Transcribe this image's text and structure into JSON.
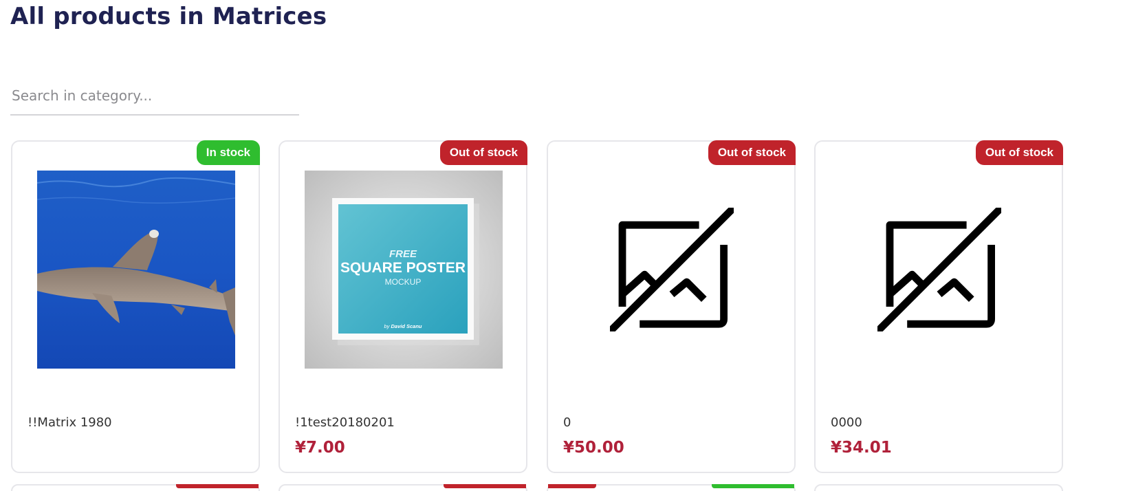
{
  "page": {
    "title": "All products in Matrices"
  },
  "search": {
    "placeholder": "Search in category..."
  },
  "products": [
    {
      "name": "!!Matrix 1980",
      "price": "",
      "stock": "In stock",
      "image": "shark-photo"
    },
    {
      "name": "!1test20180201",
      "price": "¥7.00",
      "stock": "Out of stock",
      "image": "square-poster-mockup",
      "poster": {
        "line1": "FREE",
        "line2": "SQUARE POSTER",
        "line3": "MOCKUP",
        "credit_prefix": "by",
        "credit_name": "David Scanu"
      }
    },
    {
      "name": "0",
      "price": "¥50.00",
      "stock": "Out of stock",
      "image": "broken-image-icon"
    },
    {
      "name": "0000",
      "price": "¥34.01",
      "stock": "Out of stock",
      "image": "broken-image-icon"
    }
  ],
  "colors": {
    "in_stock": "#2fbd2f",
    "out_of_stock": "#c0232b",
    "price": "#b0213a",
    "title": "#1f2252"
  }
}
